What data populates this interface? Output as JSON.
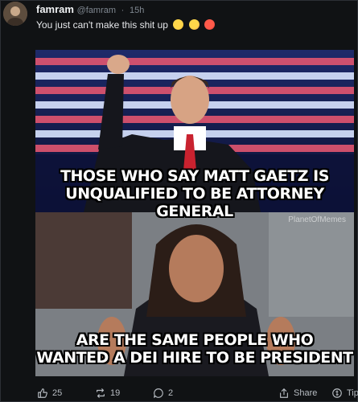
{
  "post": {
    "username": "famram",
    "handle": "@famram",
    "time": "15h",
    "text": "You just can't make this shit up",
    "emojis": [
      "thinking-face-emoji",
      "flushed-face-emoji",
      "angry-face-emoji"
    ]
  },
  "meme": {
    "top_caption_line1": "THOSE WHO SAY MATT GAETZ IS",
    "top_caption_line2": "UNQUALIFIED TO BE ATTORNEY GENERAL",
    "bottom_caption_line1": "ARE THE SAME PEOPLE WHO",
    "bottom_caption_line2": "WANTED A DEI HIRE TO BE PRESIDENT",
    "watermark": "PlanetOfMemes"
  },
  "actions": {
    "likes": "25",
    "reposts": "19",
    "comments": "2",
    "share_label": "Share",
    "tip_label": "Tip"
  }
}
